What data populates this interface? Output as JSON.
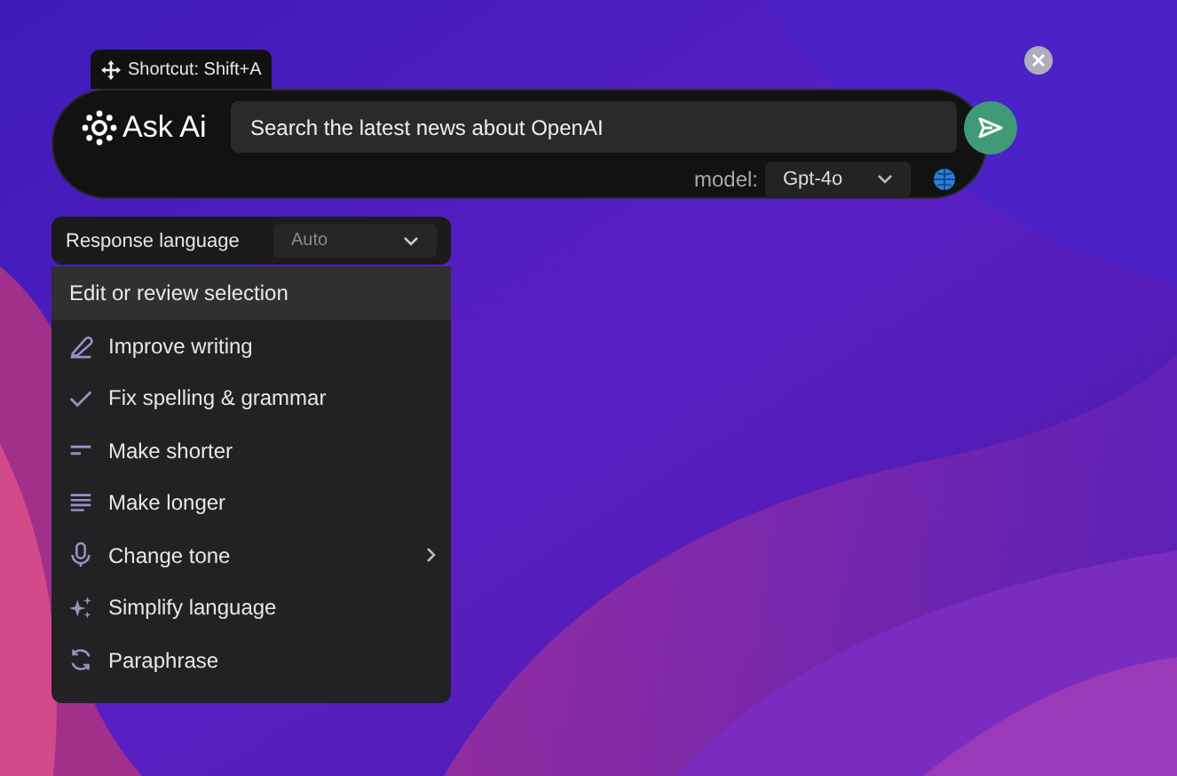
{
  "shortcut_tag": {
    "label": "Shortcut: Shift+A"
  },
  "ask_bar": {
    "logo_text": "Ask Ai",
    "query": "Search the latest news about OpenAI",
    "model_label": "model:",
    "model": "Gpt-4o"
  },
  "response_language": {
    "label": "Response language",
    "value": "Auto"
  },
  "menu": {
    "heading": "Edit or review selection",
    "items": [
      {
        "label": "Improve writing",
        "has_submenu": false
      },
      {
        "label": "Fix spelling & grammar",
        "has_submenu": false
      },
      {
        "label": "Make shorter",
        "has_submenu": false
      },
      {
        "label": "Make longer",
        "has_submenu": false
      },
      {
        "label": "Change tone",
        "has_submenu": true
      },
      {
        "label": "Simplify language",
        "has_submenu": false
      },
      {
        "label": "Paraphrase",
        "has_submenu": false
      }
    ]
  }
}
